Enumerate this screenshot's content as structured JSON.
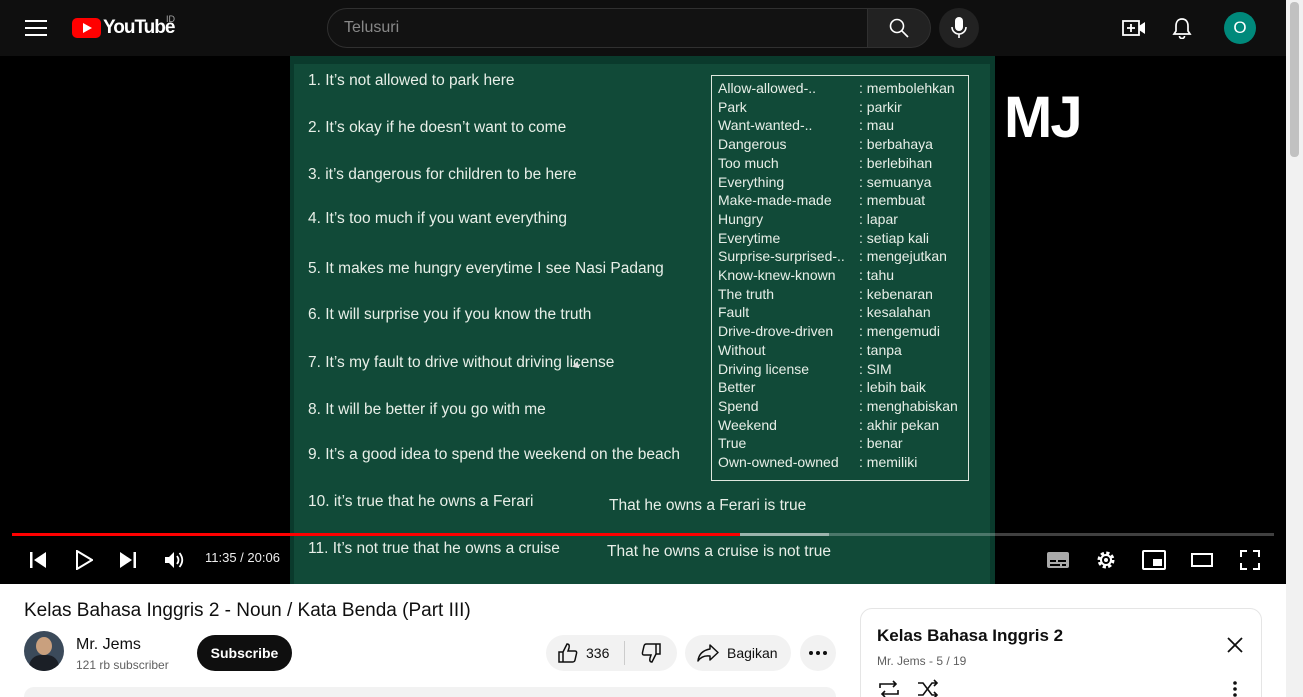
{
  "header": {
    "logo_text": "YouTube",
    "region": "ID",
    "search_placeholder": "Telusuri",
    "avatar_letter": "O"
  },
  "player": {
    "sentences": [
      "1. It’s not allowed to park here",
      "2. It’s okay if he doesn’t want to come",
      "3.  it’s dangerous for children to be here",
      "4. It’s too much if you want everything",
      "5. It makes me hungry everytime I see Nasi Padang",
      "6. It will surprise you if you know the truth",
      "7. It’s my fault to drive without driving license",
      "8. It will be better if you go with me",
      "9. It’s a good idea to spend the weekend on the beach",
      "10. it’s true that he owns a Ferari",
      "11. It’s not true that he owns a cruise"
    ],
    "rewrites": [
      "That he owns a Ferari   is   true",
      "That he owns a cruise   is not  true"
    ],
    "vocab": [
      {
        "en": "Allow-allowed-..",
        "id": ": membolehkan"
      },
      {
        "en": "Park",
        "id": ": parkir"
      },
      {
        "en": "Want-wanted-..",
        "id": ": mau"
      },
      {
        "en": "Dangerous",
        "id": ": berbahaya"
      },
      {
        "en": "Too much",
        "id": ": berlebihan"
      },
      {
        "en": "Everything",
        "id": ": semuanya"
      },
      {
        "en": "Make-made-made",
        "id": ": membuat"
      },
      {
        "en": "Hungry",
        "id": ": lapar"
      },
      {
        "en": "Everytime",
        "id": ": setiap kali"
      },
      {
        "en": "Surprise-surprised-..",
        "id": ": mengejutkan"
      },
      {
        "en": "Know-knew-known",
        "id": ": tahu"
      },
      {
        "en": "The truth",
        "id": ": kebenaran"
      },
      {
        "en": "Fault",
        "id": ": kesalahan"
      },
      {
        "en": "Drive-drove-driven",
        "id": ": mengemudi"
      },
      {
        "en": "Without",
        "id": ": tanpa"
      },
      {
        "en": "Driving license",
        "id": ": SIM"
      },
      {
        "en": "Better",
        "id": ": lebih baik"
      },
      {
        "en": "Spend",
        "id": ": menghabiskan"
      },
      {
        "en": "Weekend",
        "id": ": akhir pekan"
      },
      {
        "en": "True",
        "id": ": benar"
      },
      {
        "en": "Own-owned-owned",
        "id": ": memiliki"
      }
    ],
    "watermark": "MJ",
    "time": "11:35 / 20:06",
    "progress_played_fraction": 0.577,
    "progress_buffered_fraction": 0.647
  },
  "video": {
    "title": "Kelas Bahasa Inggris 2 - Noun / Kata Benda (Part III)",
    "channel": "Mr. Jems",
    "subscribers": "121 rb subscriber",
    "subscribe_label": "Subscribe",
    "likes": "336",
    "share_label": "Bagikan"
  },
  "playlist": {
    "title": "Kelas Bahasa Inggris 2",
    "meta": "Mr. Jems - 5 / 19"
  },
  "colors": {
    "accent_red": "#ff0000",
    "board_green": "#114a38",
    "avatar_teal": "#00897b"
  }
}
